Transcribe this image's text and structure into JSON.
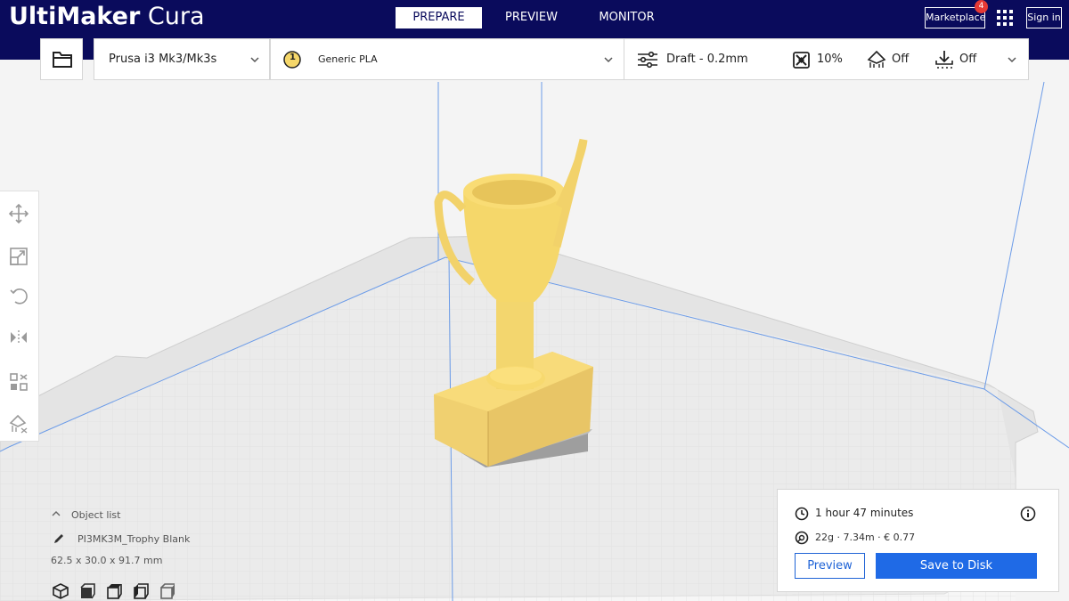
{
  "app": {
    "logo_bold": "UltiMaker",
    "logo_light": " Cura"
  },
  "stages": [
    {
      "label": "PREPARE",
      "active": true
    },
    {
      "label": "PREVIEW",
      "active": false
    },
    {
      "label": "MONITOR",
      "active": false
    }
  ],
  "header": {
    "marketplace_label": "Marketplace",
    "marketplace_badge": "4",
    "signin_label": "Sign in"
  },
  "toolbar": {
    "printer": "Prusa i3 Mk3/Mk3s",
    "extruder_number": "1",
    "material": "Generic PLA",
    "profile": "Draft - 0.2mm",
    "infill": "10%",
    "support": "Off",
    "adhesion": "Off"
  },
  "object_panel": {
    "header": "Object list",
    "object_name": "PI3MK3M_Trophy Blank",
    "dimensions": "62.5 x 30.0 x 91.7 mm"
  },
  "print_panel": {
    "time": "1 hour 47 minutes",
    "material_summary": "22g · 7.34m · € 0.77",
    "preview_label": "Preview",
    "save_label": "Save to Disk"
  },
  "colors": {
    "topbar": "#0a0b5c",
    "accent": "#1f6ae6",
    "model": "#f5d76a",
    "badge": "#e53935"
  },
  "icons": [
    "folder-icon",
    "extruder-icon",
    "chevron-down-icon",
    "settings-sliders-icon",
    "infill-icon",
    "support-icon",
    "adhesion-icon",
    "move-icon",
    "scale-icon",
    "rotate-icon",
    "mirror-icon",
    "per-model-settings-icon",
    "support-blocker-icon",
    "clock-icon",
    "spool-icon",
    "info-icon",
    "edit-icon",
    "apps-grid-icon"
  ]
}
